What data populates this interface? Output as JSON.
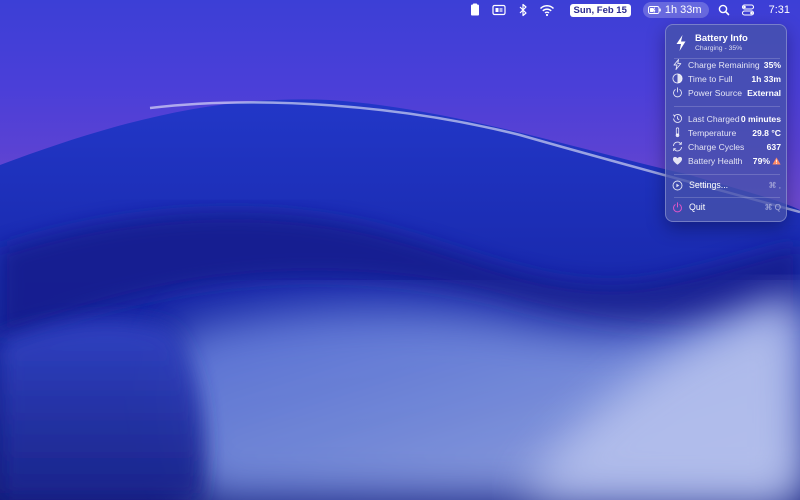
{
  "menubar": {
    "date": "Sun, Feb 15",
    "battery_time": "1h 33m",
    "clock": "7:31",
    "icons": [
      "clipboard-icon",
      "display-icon",
      "bluetooth-icon",
      "wifi-icon",
      "battery-icon",
      "search-icon",
      "control-center-icon"
    ]
  },
  "panel": {
    "title": "Battery Info",
    "subtitle": "Charging - 35%",
    "rows_a": [
      {
        "icon": "bolt-icon",
        "label": "Charge Remaining",
        "value": "35%"
      },
      {
        "icon": "clock-half-icon",
        "label": "Time to Full",
        "value": "1h 33m"
      },
      {
        "icon": "power-icon",
        "label": "Power Source",
        "value": "External"
      }
    ],
    "rows_b": [
      {
        "icon": "history-icon",
        "label": "Last Charged",
        "value": "0 minutes"
      },
      {
        "icon": "thermometer-icon",
        "label": "Temperature",
        "value": "29.8 °C"
      },
      {
        "icon": "cycle-icon",
        "label": "Charge Cycles",
        "value": "637"
      },
      {
        "icon": "heart-icon",
        "label": "Battery Health",
        "value": "79%"
      }
    ],
    "menu": [
      {
        "icon": "play-circle-icon",
        "label": "Settings...",
        "shortcut": "⌘ ,"
      },
      {
        "icon": "power-icon",
        "label": "Quit",
        "shortcut": "⌘ Q"
      }
    ]
  },
  "colors": {
    "warning": "#ff8a65",
    "quit_icon": "#e055c8",
    "accent": "#2a2a8f"
  }
}
